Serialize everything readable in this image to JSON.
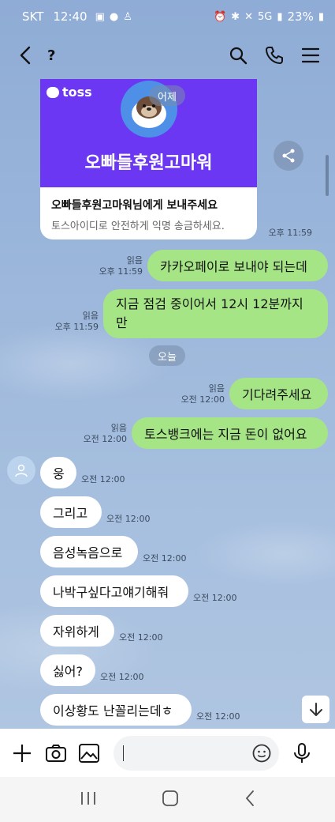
{
  "status_bar": {
    "carrier": "SKT",
    "time": "12:40",
    "network": "5G",
    "battery": "23%"
  },
  "header": {
    "title": "?"
  },
  "toss_card": {
    "brand": "toss",
    "day_label": "어제",
    "banner_title": "오빠들후원고마워",
    "line1": "오빠들후원고마워님에게 보내주세요",
    "line2": "토스아이디로 안전하게 익명 송금하세요.",
    "time": "오후 11:59"
  },
  "messages": [
    {
      "text": "카카오페이로 보내야 되는데",
      "read": "읽음",
      "time": "오후 11:59"
    },
    {
      "text": "지금 점검 중이어서 12시 12분까지 만",
      "read": "읽음",
      "time": "오후 11:59"
    },
    {
      "text": "기다려주세요",
      "read": "읽음",
      "time": "오전 12:00"
    },
    {
      "text": "토스뱅크에는 지금 돈이 없어요",
      "read": "읽음",
      "time": "오전 12:00"
    },
    {
      "text": "웅",
      "time": "오전 12:00"
    },
    {
      "text": "그리고",
      "time": "오전 12:00"
    },
    {
      "text": "음성녹음으로",
      "time": "오전 12:00"
    },
    {
      "text": "나박구싶다고얘기해줘",
      "time": "오전 12:00"
    },
    {
      "text": "자위하게",
      "time": "오전 12:00"
    },
    {
      "text": "싫어?",
      "time": "오전 12:00"
    },
    {
      "text": "이상황도 난꼴리는데ㅎ",
      "time": "오전 12:00"
    }
  ],
  "date_divider": "오늘",
  "icons": {
    "back": "chevron-left-icon",
    "search": "search-icon",
    "call": "phone-icon",
    "menu": "hamburger-menu-icon",
    "share": "share-icon",
    "plus": "plus-icon",
    "camera": "camera-icon",
    "gallery": "image-icon",
    "emoji": "emoji-icon",
    "mic": "microphone-icon",
    "scroll_down": "arrow-down-icon"
  },
  "colors": {
    "background": "#9bb7d9",
    "my_bubble": "#a5e585",
    "other_bubble": "#ffffff",
    "toss_purple": "#6b37f3"
  }
}
